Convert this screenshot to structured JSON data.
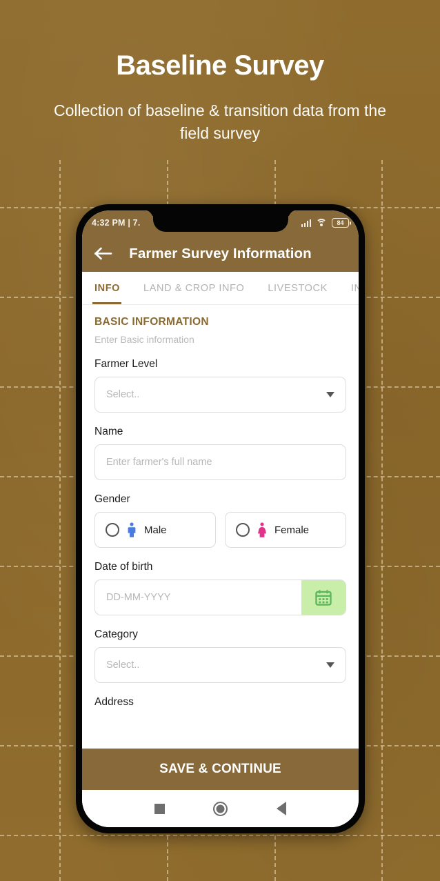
{
  "hero": {
    "title": "Baseline Survey",
    "subtitle": "Collection of baseline & transition data from the field survey"
  },
  "colors": {
    "background": "#8d6a2c",
    "brand": "#87693a",
    "accent_green": "#c8eeaa",
    "calendar_icon": "#5cb85c",
    "male_icon": "#4a7ce0",
    "female_icon": "#e0338a"
  },
  "phone": {
    "status_bar": {
      "time": "4:32 PM | 7.",
      "battery_level": "84",
      "icons": [
        "signal-icon",
        "wifi-icon",
        "battery-icon"
      ]
    },
    "app_bar": {
      "back_icon": "back-arrow-icon",
      "title": "Farmer Survey Information"
    },
    "tabs": [
      {
        "label": "INFO",
        "active": true
      },
      {
        "label": "LAND & CROP INFO",
        "active": false
      },
      {
        "label": "LIVESTOCK",
        "active": false
      },
      {
        "label": "INCO",
        "active": false
      }
    ],
    "form": {
      "section_title": "BASIC INFORMATION",
      "section_subtitle": "Enter Basic information",
      "fields": {
        "farmer_level": {
          "label": "Farmer Level",
          "value": "",
          "placeholder": "Select..",
          "type": "dropdown"
        },
        "name": {
          "label": "Name",
          "value": "",
          "placeholder": "Enter farmer's full name",
          "type": "text"
        },
        "gender": {
          "label": "Gender",
          "options": [
            {
              "label": "Male",
              "selected": false,
              "icon": "male-person-icon"
            },
            {
              "label": "Female",
              "selected": false,
              "icon": "female-person-icon"
            }
          ]
        },
        "date_of_birth": {
          "label": "Date of birth",
          "value": "",
          "placeholder": "DD-MM-YYYY",
          "button_icon": "calendar-icon"
        },
        "category": {
          "label": "Category",
          "value": "",
          "placeholder": "Select..",
          "type": "dropdown"
        },
        "address": {
          "label": "Address"
        }
      }
    },
    "save_button": "SAVE & CONTINUE",
    "nav_bar": {
      "recents": "recents-square-icon",
      "home": "home-circle-icon",
      "back": "back-triangle-icon"
    }
  }
}
